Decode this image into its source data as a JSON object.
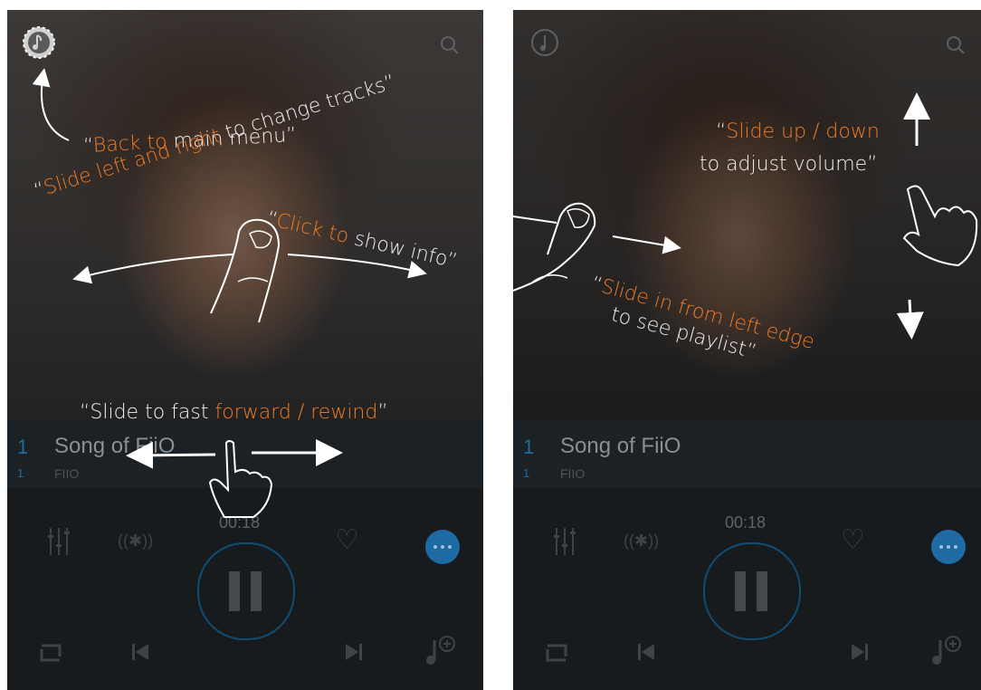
{
  "left": {
    "annot_back_open": "“",
    "annot_back_o": "Back to",
    "annot_back_w": " main menu",
    "annot_back_close": "”",
    "annot_slide_o": "Slide left and right",
    "annot_slide_w": " to change tracks",
    "annot_click_o": "Click to",
    "annot_click_w": " show info",
    "annot_ff_w": "Slide to fast ",
    "annot_ff_o": "forward / rewind"
  },
  "right": {
    "annot_vol_o": "Slide up / down",
    "annot_vol_w": "to adjust volume",
    "annot_edge_o": "Slide in from left edge",
    "annot_edge_w": "to see playlist"
  },
  "player": {
    "track_number": "1",
    "track_sub_number": "1",
    "title": "Song of FiiO",
    "artist": "FIIO",
    "time": "00:18"
  },
  "icons": {
    "menu": "music-note-circle-icon",
    "search": "search-icon",
    "equalizer": "equalizer-icon",
    "bluetooth": "bluetooth-icon",
    "favorite": "heart-icon",
    "more": "more-icon",
    "pause": "pause-icon",
    "repeat": "repeat-icon",
    "previous": "previous-icon",
    "next": "next-icon",
    "add_to_playlist": "add-music-icon"
  },
  "colors": {
    "accent_orange": "#f07c24",
    "accent_blue": "#1e6aa3"
  }
}
